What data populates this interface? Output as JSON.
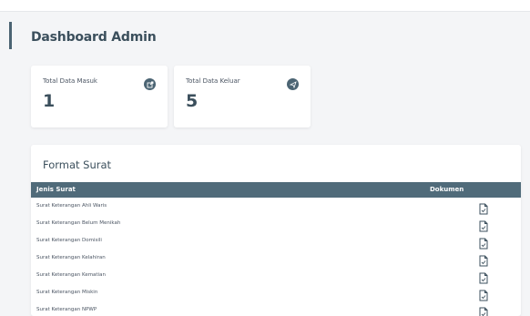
{
  "header": {
    "title": "Dashboard Admin"
  },
  "stats": [
    {
      "label": "Total Data Masuk",
      "value": "1",
      "icon": "external-link-icon"
    },
    {
      "label": "Total Data Keluar",
      "value": "5",
      "icon": "send-icon"
    }
  ],
  "table": {
    "title": "Format Surat",
    "columns": {
      "jenis": "Jenis Surat",
      "dokumen": "Dokumen"
    },
    "rows": [
      "Surat Keterangan Ahli Waris",
      "Surat Keterangan Belum Menikah",
      "Surat Keterangan Domisili",
      "Surat Keterangan Kelahiran",
      "Surat Keterangan Kematian",
      "Surat Keterangan Miskin",
      "Surat Keterangan NPWP"
    ],
    "doc_icon": "document-icon"
  },
  "colors": {
    "accent": "#4b6473",
    "table_header": "#506b7a",
    "background": "#f4f5f7"
  }
}
